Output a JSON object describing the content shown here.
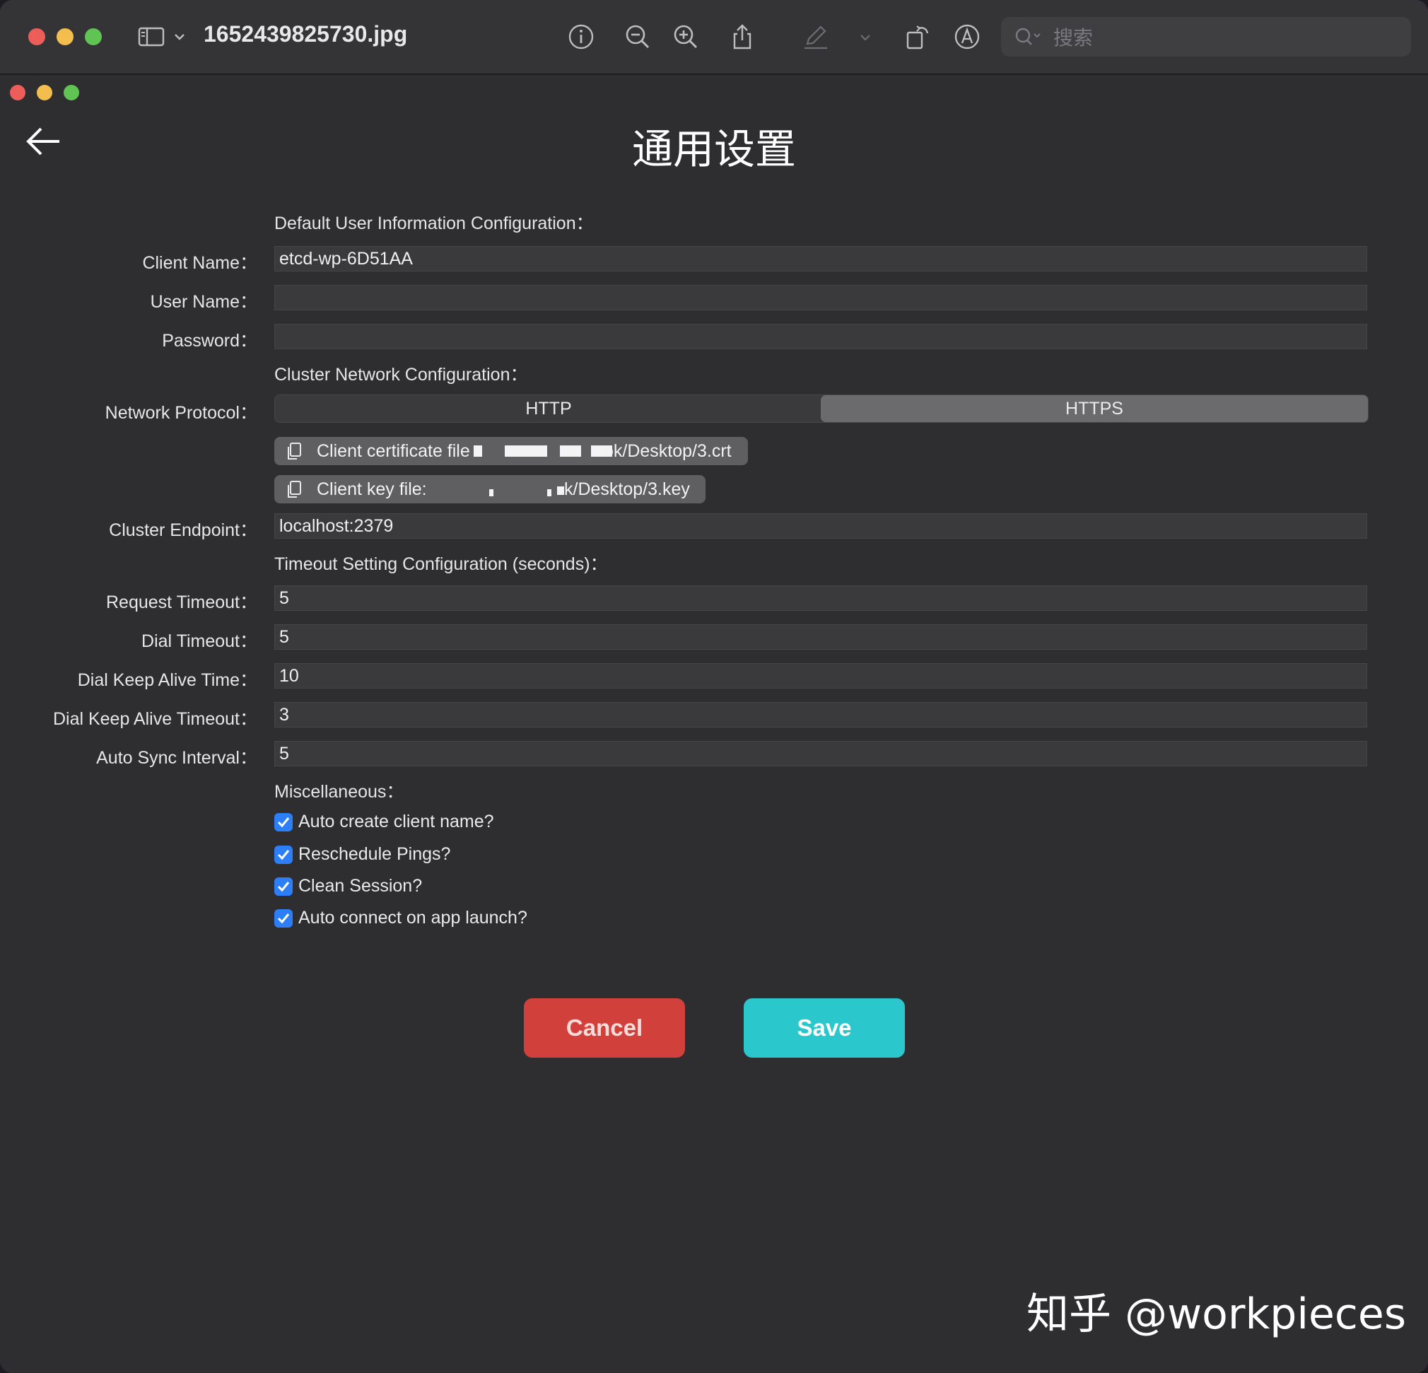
{
  "preview": {
    "filename": "1652439825730.jpg",
    "search_placeholder": "搜索"
  },
  "app": {
    "title": "通用设置",
    "sections": {
      "user_info": "Default User Information Configuration：",
      "network": "Cluster Network Configuration：",
      "timeout": "Timeout Setting Configuration (seconds)：",
      "misc": "Miscellaneous："
    },
    "fields": {
      "client_name": {
        "label": "Client Name：",
        "value": "etcd-wp-6D51AA"
      },
      "user_name": {
        "label": "User Name：",
        "value": ""
      },
      "password": {
        "label": "Password：",
        "value": ""
      },
      "network_protocol": {
        "label": "Network Protocol："
      },
      "cluster_endpoint": {
        "label": "Cluster Endpoint：",
        "value": "localhost:2379"
      },
      "request_timeout": {
        "label": "Request Timeout：",
        "value": "5"
      },
      "dial_timeout": {
        "label": "Dial Timeout：",
        "value": "5"
      },
      "dial_keep_alive_time": {
        "label": "Dial Keep Alive Time：",
        "value": "10"
      },
      "dial_keep_alive_timeout": {
        "label": "Dial Keep Alive Timeout：",
        "value": "3"
      },
      "auto_sync_interval": {
        "label": "Auto Sync Interval：",
        "value": "5"
      }
    },
    "protocol": {
      "options": [
        "HTTP",
        "HTTPS"
      ],
      "selected": "HTTPS"
    },
    "files": {
      "cert_prefix": "Client certificate file",
      "cert_suffix": "ok/Desktop/3.crt",
      "key_prefix": "Client key file:",
      "key_suffix": "k/Desktop/3.key"
    },
    "checkboxes": [
      {
        "label": "Auto create client name?",
        "checked": true
      },
      {
        "label": "Reschedule Pings?",
        "checked": true
      },
      {
        "label": "Clean Session?",
        "checked": true
      },
      {
        "label": "Auto connect on app launch?",
        "checked": true
      }
    ],
    "buttons": {
      "cancel": "Cancel",
      "save": "Save"
    }
  },
  "watermark": "知乎 @workpieces",
  "colors": {
    "cancel": "#d2403b",
    "save": "#2ac8cc",
    "checkbox": "#2d7ff7",
    "segment_selected": "#6b6b6e"
  }
}
